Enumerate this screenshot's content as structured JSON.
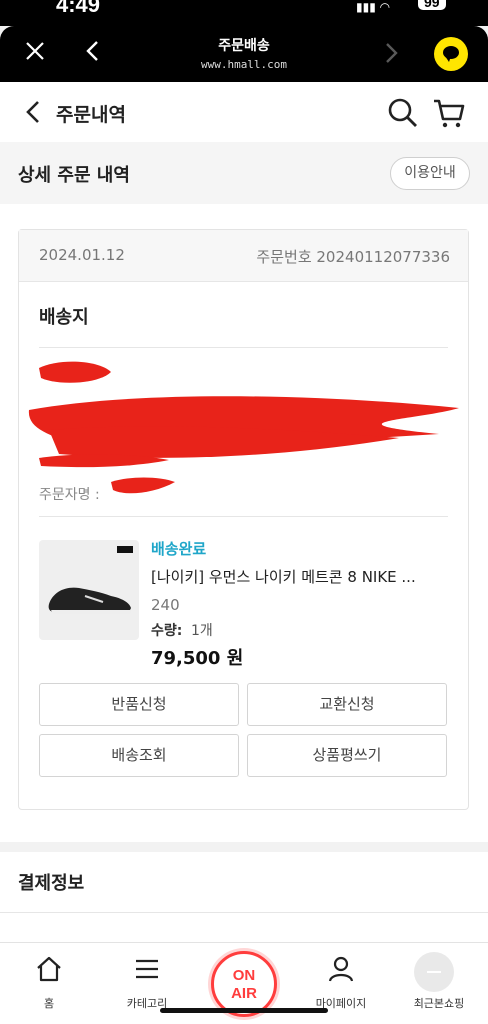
{
  "status_bar": {
    "time": "4:49",
    "battery": "99"
  },
  "webview": {
    "title": "주문배송",
    "url": "www.hmall.com"
  },
  "header": {
    "title": "주문내역"
  },
  "section": {
    "title": "상세 주문 내역",
    "guide_button": "이용안내"
  },
  "order": {
    "date": "2024.01.12",
    "order_number": "주문번호 20240112077336",
    "shipping_title": "배송지",
    "orderer_label": "주문자명 :"
  },
  "product": {
    "status": "배송완료",
    "name": "[나이키] 우먼스 나이키 메트콘 8 NIKE ...",
    "option": "240",
    "qty_label": "수량:",
    "qty_value": "1개",
    "price": "79,500 원"
  },
  "actions": {
    "return": "반품신청",
    "exchange": "교환신청",
    "track": "배송조회",
    "review": "상품평쓰기"
  },
  "payment": {
    "title": "결제정보"
  },
  "nav": {
    "home": "홈",
    "category": "카테고리",
    "onair_1": "ON",
    "onair_2": "AIR",
    "mypage": "마이페이지",
    "recent": "최근본쇼핑"
  },
  "colors": {
    "status": "#1fa6c9",
    "onair": "#ff3d3d",
    "kakao": "#ffe500"
  }
}
